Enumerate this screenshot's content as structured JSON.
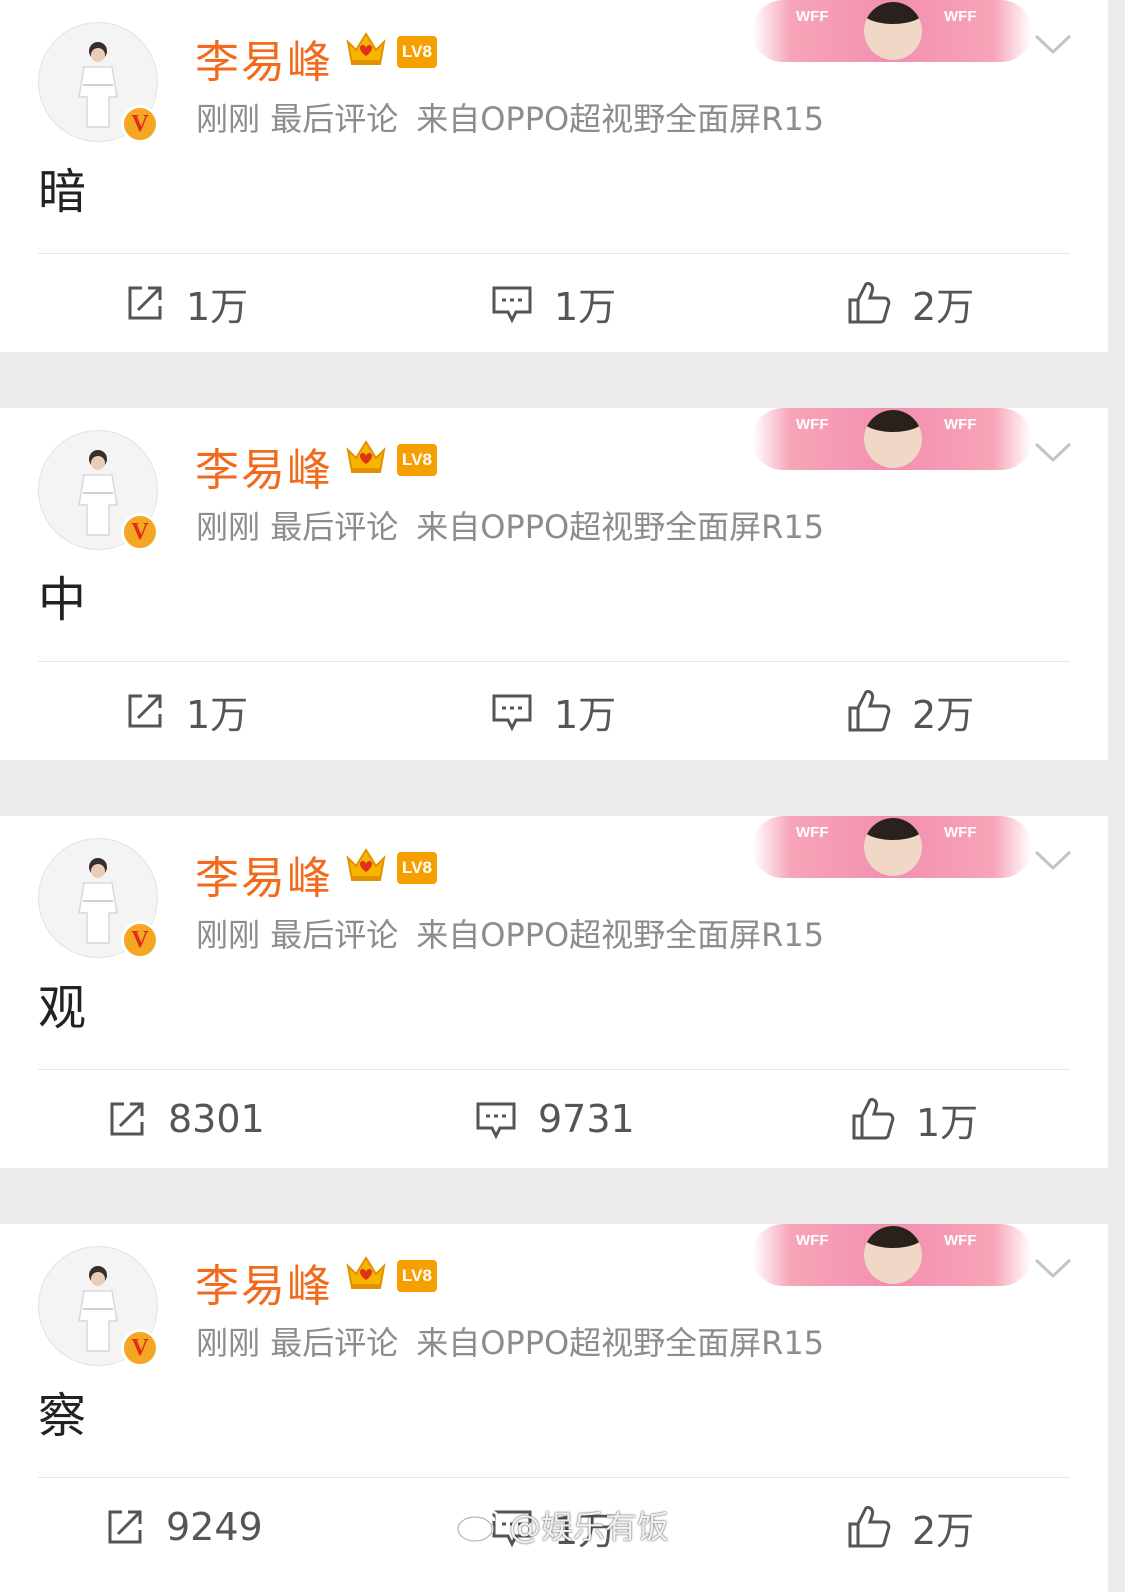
{
  "posts": [
    {
      "username": "李易峰",
      "level": "LV8",
      "time": "刚刚",
      "last_comment": "最后评论",
      "source": "来自OPPO超视野全面屏R15",
      "content": "暗",
      "banner_wff": "WFF",
      "actions": {
        "repost": "1万",
        "comment": "1万",
        "like": "2万"
      }
    },
    {
      "username": "李易峰",
      "level": "LV8",
      "time": "刚刚",
      "last_comment": "最后评论",
      "source": "来自OPPO超视野全面屏R15",
      "content": "中",
      "banner_wff": "WFF",
      "actions": {
        "repost": "1万",
        "comment": "1万",
        "like": "2万"
      }
    },
    {
      "username": "李易峰",
      "level": "LV8",
      "time": "刚刚",
      "last_comment": "最后评论",
      "source": "来自OPPO超视野全面屏R15",
      "content": "观",
      "banner_wff": "WFF",
      "actions": {
        "repost": "8301",
        "comment": "9731",
        "like": "1万"
      }
    },
    {
      "username": "李易峰",
      "level": "LV8",
      "time": "刚刚",
      "last_comment": "最后评论",
      "source": "来自OPPO超视野全面屏R15",
      "content": "察",
      "banner_wff": "WFF",
      "actions": {
        "repost": "9249",
        "comment": "1万",
        "like": "2万"
      }
    }
  ],
  "watermark": {
    "text": "@娱乐有饭"
  },
  "icons": {
    "avatar_badge": "verified-v-icon",
    "crown": "crown-icon",
    "menu": "chevron-down-icon",
    "repost": "repost-icon",
    "comment": "comment-icon",
    "like": "thumbs-up-icon",
    "watermark": "weibo-logo-icon"
  },
  "colors": {
    "username": "#f26a1b",
    "level_badge": "#f5a000",
    "meta_text": "#8c8c8c",
    "action_text": "#555555",
    "page_bg": "#ececec",
    "card_bg": "#ffffff"
  }
}
